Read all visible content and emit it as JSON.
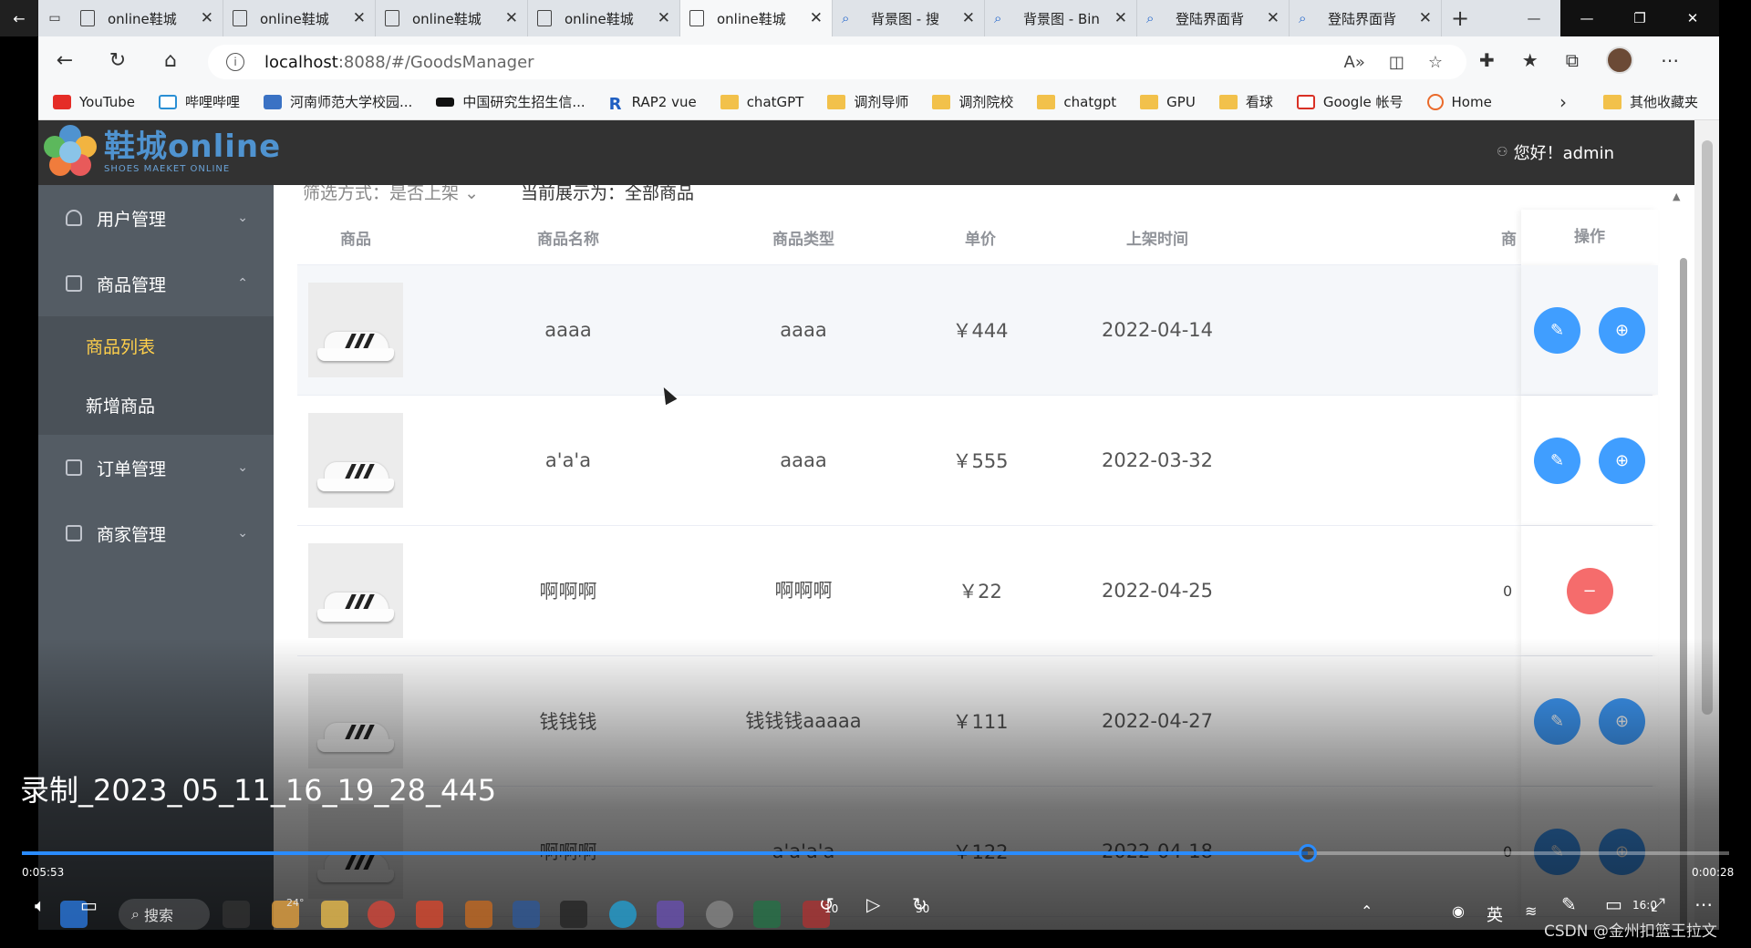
{
  "browser": {
    "tabs": [
      {
        "label": "online鞋城",
        "icon": "page-icon",
        "active": false
      },
      {
        "label": "online鞋城",
        "icon": "page-icon",
        "active": false
      },
      {
        "label": "online鞋城",
        "icon": "page-icon",
        "active": false
      },
      {
        "label": "online鞋城",
        "icon": "page-icon",
        "active": false
      },
      {
        "label": "online鞋城",
        "icon": "page-icon",
        "active": true
      },
      {
        "label": "背景图 - 搜",
        "icon": "search-icon",
        "active": false
      },
      {
        "label": "背景图 - Bin",
        "icon": "search-icon",
        "active": false
      },
      {
        "label": "登陆界面背",
        "icon": "search-icon",
        "active": false
      },
      {
        "label": "登陆界面背",
        "icon": "search-icon",
        "active": false
      }
    ],
    "url_host": "localhost",
    "url_path": ":8088/#/GoodsManager",
    "bookmarks": [
      {
        "label": "YouTube",
        "icon": "yt"
      },
      {
        "label": "哔哩哔哩",
        "icon": "bili"
      },
      {
        "label": "河南师范大学校园...",
        "icon": "henu"
      },
      {
        "label": "中国研究生招生信...",
        "icon": "cap"
      },
      {
        "label": "RAP2 vue",
        "icon": "rap"
      },
      {
        "label": "chatGPT",
        "icon": "folder"
      },
      {
        "label": "调剂导师",
        "icon": "folder"
      },
      {
        "label": "调剂院校",
        "icon": "folder"
      },
      {
        "label": "chatgpt",
        "icon": "folder"
      },
      {
        "label": "GPU",
        "icon": "folder"
      },
      {
        "label": "看球",
        "icon": "folder"
      },
      {
        "label": "Google 帐号",
        "icon": "gmail"
      },
      {
        "label": "Home",
        "icon": "home"
      }
    ],
    "other_bookmarks": "其他收藏夹"
  },
  "app": {
    "logo_main": "鞋城online",
    "logo_sub": "SHOES MAEKET ONLINE",
    "greeting": "您好！admin",
    "sidebar": {
      "user_mgmt": "用户管理",
      "goods_mgmt": "商品管理",
      "goods_list": "商品列表",
      "add_goods": "新增商品",
      "order_mgmt": "订单管理",
      "merchant_mgmt": "商家管理"
    },
    "filter": {
      "label": "筛选方式：",
      "value": "是否上架",
      "current_label": "当前展示为：",
      "current_value": "全部商品"
    },
    "table": {
      "headers": {
        "image": "商品",
        "name": "商品名称",
        "type": "商品类型",
        "price": "单价",
        "time": "上架时间",
        "extra": "商",
        "ops": "操作"
      },
      "rows": [
        {
          "name": "aaaa",
          "type": "aaaa",
          "price": "￥444",
          "time": "2022-04-14",
          "extra": "",
          "state": "on"
        },
        {
          "name": "a'a'a",
          "type": "aaaa",
          "price": "￥555",
          "time": "2022-03-32",
          "extra": "",
          "state": "on"
        },
        {
          "name": "啊啊啊",
          "type": "啊啊啊",
          "price": "￥22",
          "time": "2022-04-25",
          "extra": "0",
          "state": "off"
        },
        {
          "name": "钱钱钱",
          "type": "钱钱钱aaaaa",
          "price": "￥111",
          "time": "2022-04-27",
          "extra": "",
          "state": "on"
        },
        {
          "name": "啊啊啊",
          "type": "a'a'a'a",
          "price": "￥122",
          "time": "2022-04-18",
          "extra": "0",
          "state": "on"
        }
      ]
    }
  },
  "player": {
    "title": "录制_2023_05_11_16_19_28_445",
    "current_time": "0:05:53",
    "end_time": "0:00:28",
    "progress": 0.753,
    "rewind_label": "10",
    "forward_label": "30"
  },
  "taskbar": {
    "search": "搜索",
    "weather": "24°",
    "ime": "英",
    "clock": "16:0"
  },
  "watermark": "CSDN @金州扣篮王拉文"
}
